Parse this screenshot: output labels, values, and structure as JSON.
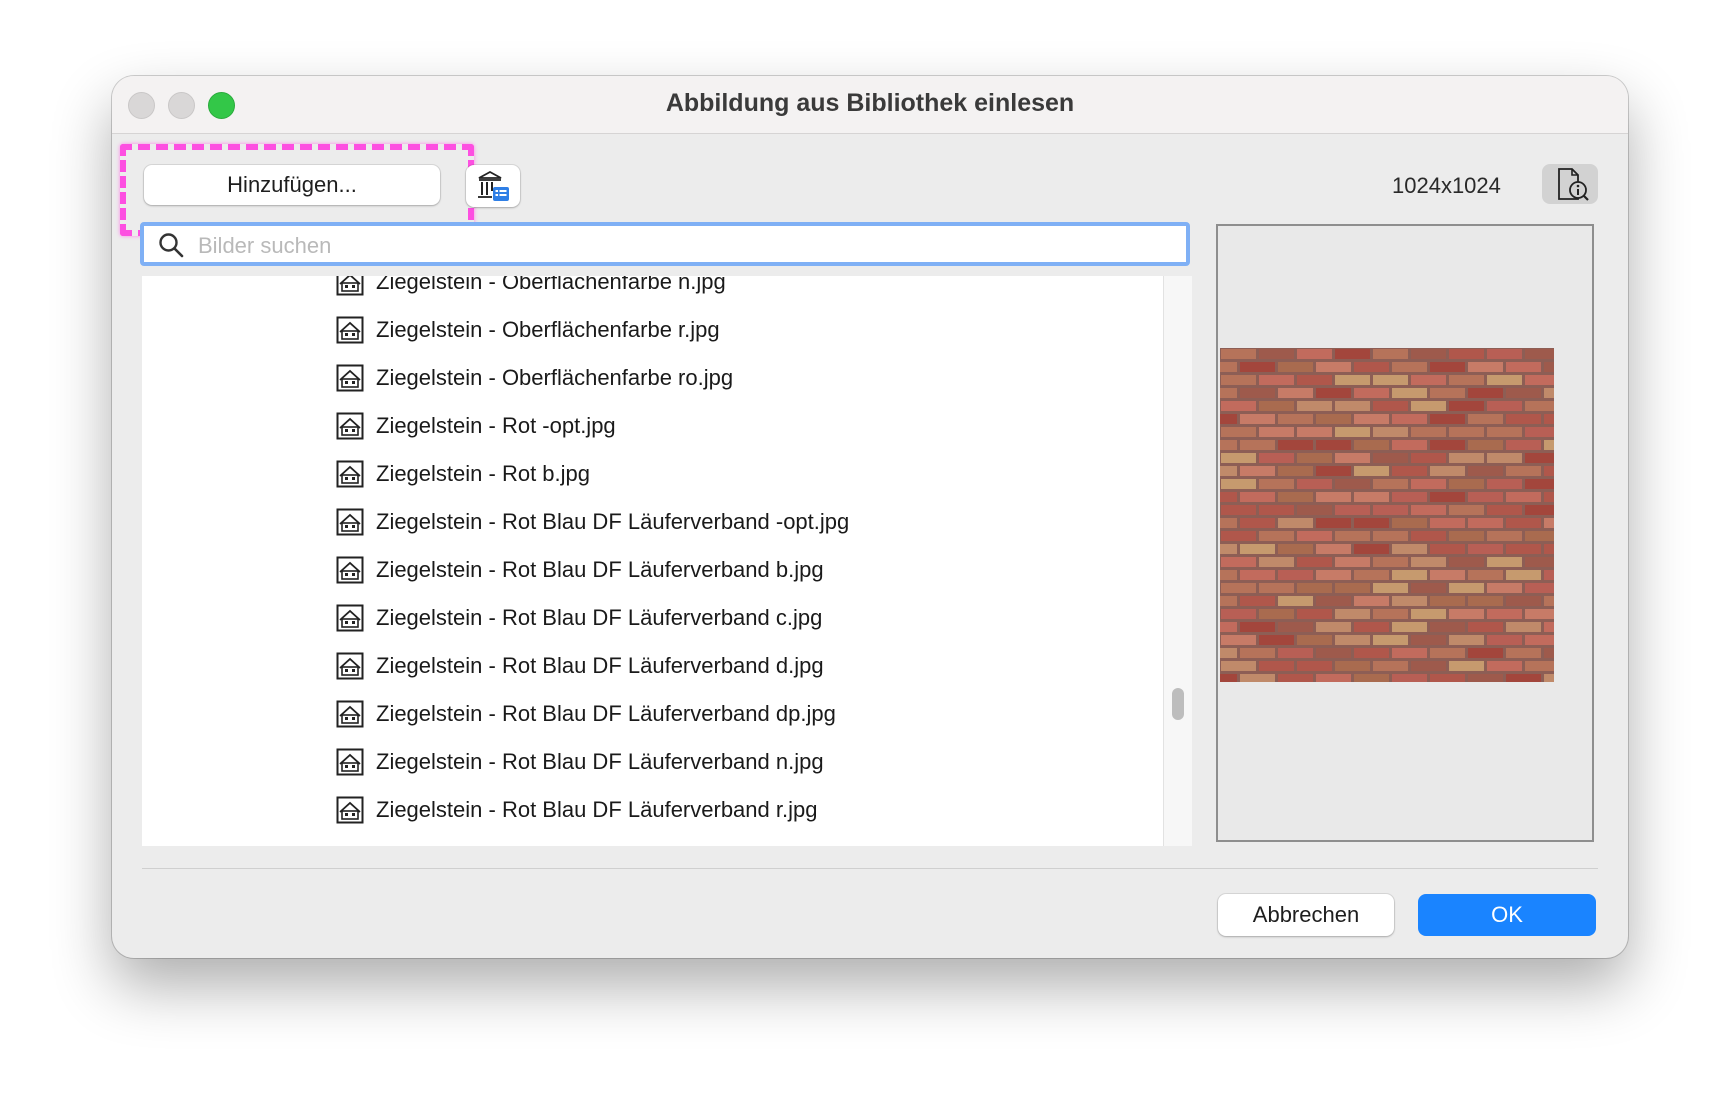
{
  "window": {
    "title": "Abbildung aus Bibliothek einlesen"
  },
  "toolbar": {
    "add_label": "Hinzufügen...",
    "library_icon": "library-list-icon",
    "image_dimensions": "1024x1024",
    "info_icon": "document-info-icon"
  },
  "search": {
    "placeholder": "Bilder suchen",
    "value": ""
  },
  "list": {
    "items": [
      "Ziegelstein - Oberflächenfarbe n.jpg",
      "Ziegelstein - Oberflächenfarbe r.jpg",
      "Ziegelstein - Oberflächenfarbe ro.jpg",
      "Ziegelstein - Rot -opt.jpg",
      "Ziegelstein - Rot b.jpg",
      "Ziegelstein - Rot Blau DF Läuferverband -opt.jpg",
      "Ziegelstein - Rot Blau DF Läuferverband b.jpg",
      "Ziegelstein - Rot Blau DF Läuferverband c.jpg",
      "Ziegelstein - Rot Blau DF Läuferverband d.jpg",
      "Ziegelstein - Rot Blau DF Läuferverband dp.jpg",
      "Ziegelstein - Rot Blau DF Läuferverband n.jpg",
      "Ziegelstein - Rot Blau DF Läuferverband r.jpg"
    ],
    "item_icon": "image-file-icon"
  },
  "footer": {
    "cancel_label": "Abbrechen",
    "ok_label": "OK"
  },
  "colors": {
    "accent": "#1a84ff",
    "highlight": "#ff3fe0",
    "zoom": "#33c748",
    "search_focus": "#7fb0f5"
  }
}
